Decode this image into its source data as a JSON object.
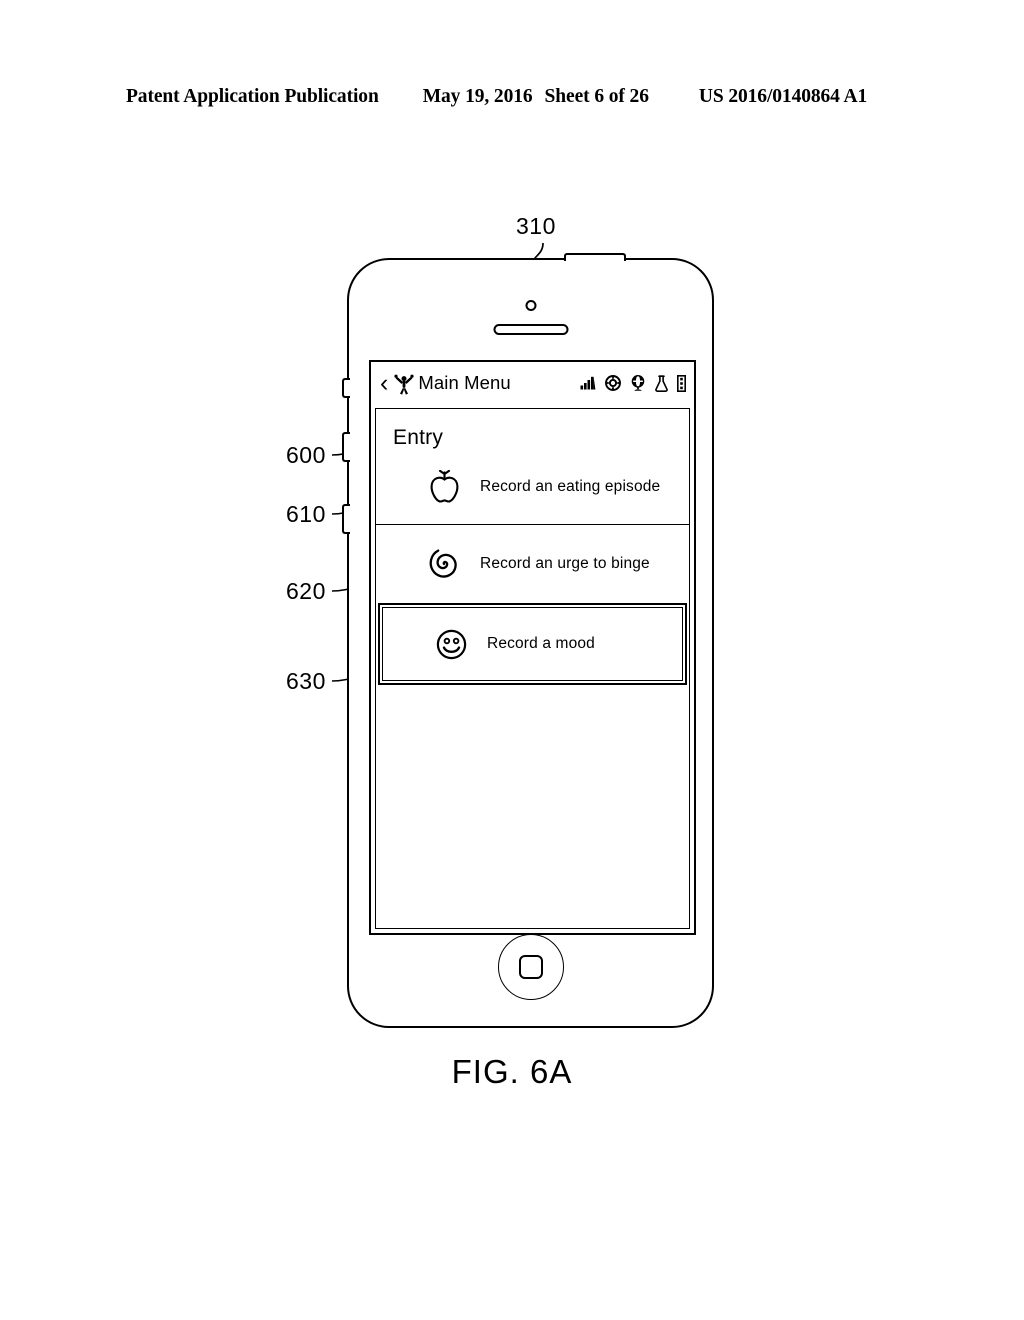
{
  "header": {
    "title": "Patent Application Publication",
    "date": "May 19, 2016",
    "sheet": "Sheet 6 of 26",
    "number": "US 2016/0140864 A1"
  },
  "figure": {
    "caption": "FIG. 6A",
    "device_ref": "310"
  },
  "reference_numerals": [
    {
      "id": "600",
      "label": "600",
      "target": "entry-section-header"
    },
    {
      "id": "610",
      "label": "610",
      "target": "record-eating-episode-row"
    },
    {
      "id": "620",
      "label": "620",
      "target": "record-urge-to-binge-row"
    },
    {
      "id": "630",
      "label": "630",
      "target": "record-mood-row-selected"
    }
  ],
  "phone": {
    "navbar": {
      "back_label": "‹",
      "back_icon": "chevron-left-icon",
      "app_logo_icon": "person-arms-raised-icon",
      "title": "Main Menu",
      "icons": [
        {
          "name": "signal-bars-icon",
          "label": "signal"
        },
        {
          "name": "lifebuoy-icon",
          "label": "support"
        },
        {
          "name": "globe-icon",
          "label": "globe"
        },
        {
          "name": "flask-icon",
          "label": "flask"
        },
        {
          "name": "overflow-menu-icon",
          "label": "more"
        }
      ]
    },
    "screen": {
      "section_title": "Entry",
      "menu_items": [
        {
          "icon": "apple-icon",
          "label": "Record an eating episode",
          "selected": false
        },
        {
          "icon": "spiral-icon",
          "label": "Record an urge to binge",
          "selected": false
        },
        {
          "icon": "smiley-face-icon",
          "label": "Record a mood",
          "selected": true
        }
      ]
    },
    "hardware": {
      "camera": "front-camera",
      "speaker": "earpiece-speaker",
      "home_button": "home-button",
      "power_button": "power-button",
      "volume_buttons": "volume-buttons"
    }
  },
  "colors": {
    "ink": "#000000",
    "paper": "#ffffff"
  }
}
